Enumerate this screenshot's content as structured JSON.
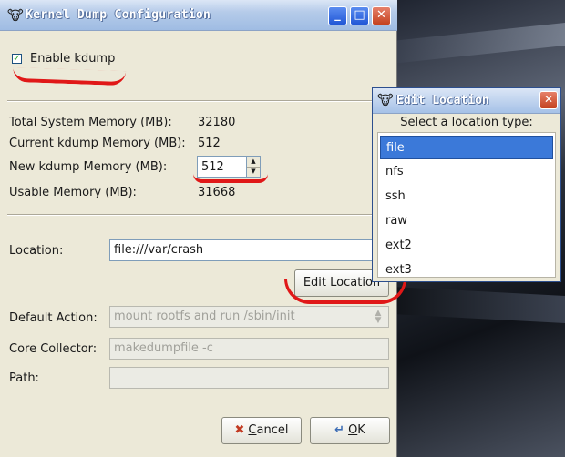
{
  "window": {
    "title": "Kernel Dump Configuration",
    "minimize": "_",
    "maximize": "□",
    "close": "✕"
  },
  "enable_kdump": {
    "label": "Enable kdump",
    "checked": true
  },
  "memory": {
    "total_label": "Total System Memory (MB):",
    "total_value": "32180",
    "current_label": "Current kdump Memory (MB):",
    "current_value": "512",
    "new_label": "New kdump Memory (MB):",
    "new_value": "512",
    "usable_label": "Usable Memory (MB):",
    "usable_value": "31668"
  },
  "location": {
    "label": "Location:",
    "value": "file:///var/crash",
    "edit_button": "Edit Location"
  },
  "default_action": {
    "label": "Default Action:",
    "value": "mount rootfs and run /sbin/init"
  },
  "core_collector": {
    "label": "Core Collector:",
    "value": "makedumpfile -c"
  },
  "path": {
    "label": "Path:",
    "value": ""
  },
  "buttons": {
    "cancel_ul": "C",
    "cancel_rest": "ancel",
    "ok_ul": "O",
    "ok_rest": "K"
  },
  "popup": {
    "title": "Edit Location",
    "close": "✕",
    "prompt": "Select a location type:",
    "items": [
      "file",
      "nfs",
      "ssh",
      "raw",
      "ext2",
      "ext3"
    ],
    "selected": "file"
  },
  "colors": {
    "annotation": "#e01818",
    "selection": "#3b79d9"
  }
}
